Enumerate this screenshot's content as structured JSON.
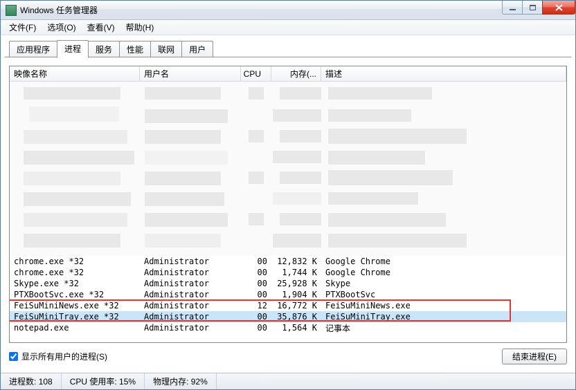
{
  "window": {
    "title": "Windows 任务管理器"
  },
  "menu": {
    "file": "文件(F)",
    "options": "选项(O)",
    "view": "查看(V)",
    "help": "帮助(H)"
  },
  "tabs": {
    "apps": "应用程序",
    "procs": "进程",
    "services": "服务",
    "perf": "性能",
    "net": "联网",
    "users": "用户"
  },
  "cols": {
    "image": "映像名称",
    "user": "用户名",
    "cpu": "CPU",
    "mem": "内存(...",
    "desc": "描述"
  },
  "rows": [
    {
      "image": "chrome.exe *32",
      "user": "Administrator",
      "cpu": "00",
      "mem": "12,832 K",
      "desc": "Google Chrome",
      "sel": false
    },
    {
      "image": "chrome.exe *32",
      "user": "Administrator",
      "cpu": "00",
      "mem": "1,744 K",
      "desc": "Google Chrome",
      "sel": false
    },
    {
      "image": "Skype.exe *32",
      "user": "Administrator",
      "cpu": "00",
      "mem": "25,928 K",
      "desc": "Skype",
      "sel": false
    },
    {
      "image": "PTXBootSvc.exe *32",
      "user": "Administrator",
      "cpu": "00",
      "mem": "1,904 K",
      "desc": "PTXBootSvc",
      "sel": false
    },
    {
      "image": "FeiSuMiniNews.exe *32",
      "user": "Administrator",
      "cpu": "12",
      "mem": "16,772 K",
      "desc": "FeiSuMiniNews.exe",
      "sel": false
    },
    {
      "image": "FeiSuMiniTray.exe *32",
      "user": "Administrator",
      "cpu": "00",
      "mem": "35,876 K",
      "desc": "FeiSuMiniTray.exe",
      "sel": true
    },
    {
      "image": "notepad.exe",
      "user": "Administrator",
      "cpu": "00",
      "mem": "1,564 K",
      "desc": "记事本",
      "sel": false
    }
  ],
  "showall": "显示所有用户的进程(S)",
  "endbtn": "结束进程(E)",
  "status": {
    "procs": "进程数: 108",
    "cpu": "CPU 使用率: 15%",
    "mem": "物理内存: 92%"
  }
}
